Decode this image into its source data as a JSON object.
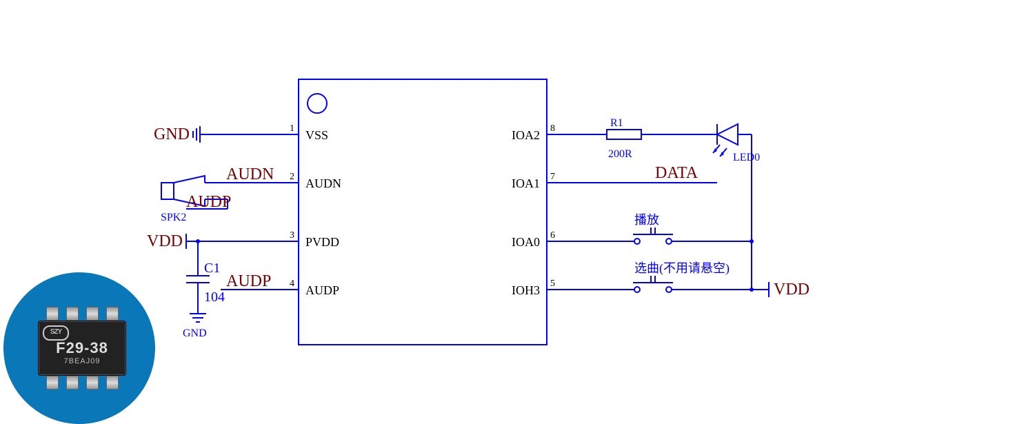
{
  "ic": {
    "pins_left": [
      {
        "num": "1",
        "name": "VSS"
      },
      {
        "num": "2",
        "name": "AUDN"
      },
      {
        "num": "3",
        "name": "PVDD"
      },
      {
        "num": "4",
        "name": "AUDP"
      }
    ],
    "pins_right": [
      {
        "num": "8",
        "name": "IOA2"
      },
      {
        "num": "7",
        "name": "IOA1"
      },
      {
        "num": "6",
        "name": "IOA0"
      },
      {
        "num": "5",
        "name": "IOH3"
      }
    ]
  },
  "nets": {
    "gnd": "GND",
    "vdd_left": "VDD",
    "vdd_right": "VDD",
    "audn": "AUDN",
    "audp_top": "AUDP",
    "audp_bottom": "AUDP",
    "data": "DATA"
  },
  "comp": {
    "speaker_ref": "SPK2",
    "cap_ref": "C1",
    "cap_val": "104",
    "cap_gnd": "GND",
    "res_ref": "R1",
    "res_val": "200R",
    "led_ref": "LED0",
    "btn_play": "播放",
    "btn_select": "选曲(不用请悬空)"
  },
  "chip_photo": {
    "logo": "SZY",
    "part": "F29-38",
    "lot": "7BEAJ09"
  }
}
